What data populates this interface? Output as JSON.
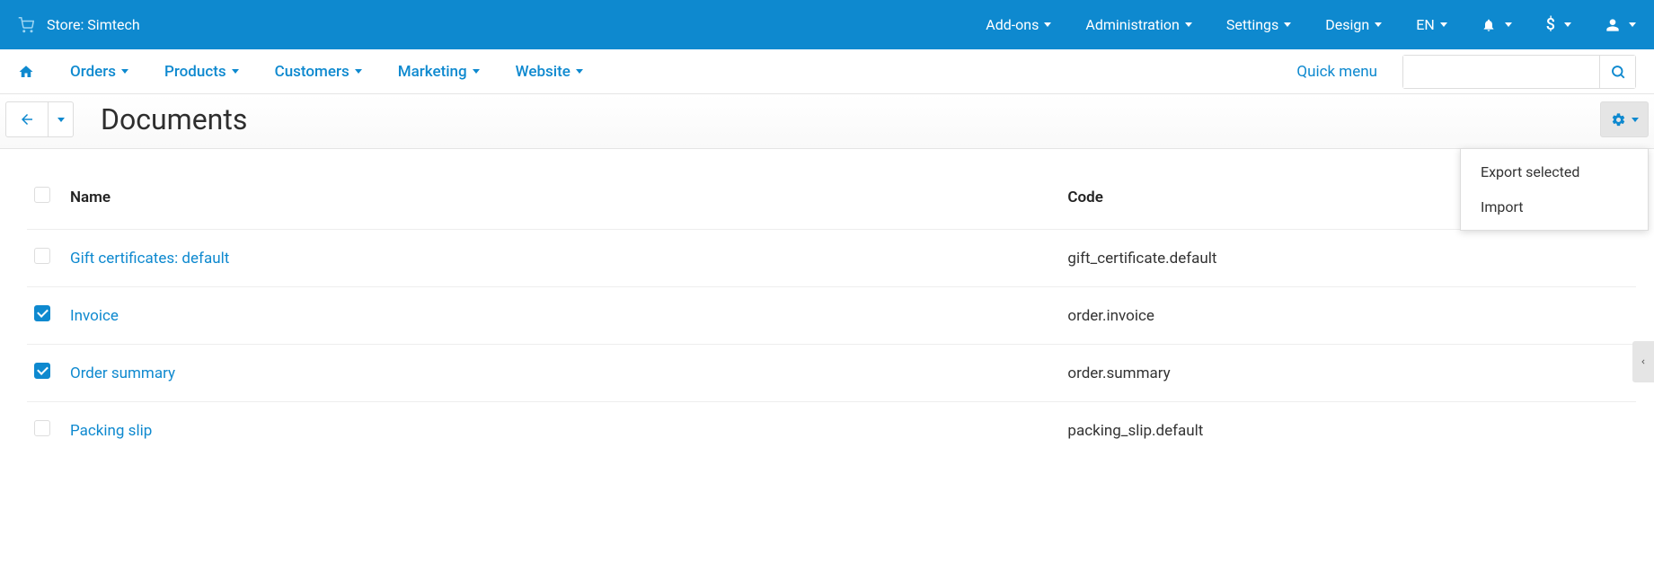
{
  "topbar": {
    "store_label": "Store: Simtech",
    "menu": {
      "addons": "Add-ons",
      "administration": "Administration",
      "settings": "Settings",
      "design": "Design",
      "language": "EN",
      "currency": "$"
    }
  },
  "navbar": {
    "orders": "Orders",
    "products": "Products",
    "customers": "Customers",
    "marketing": "Marketing",
    "website": "Website",
    "quick_menu": "Quick menu"
  },
  "page": {
    "title": "Documents"
  },
  "gear_menu": {
    "export_selected": "Export selected",
    "import": "Import"
  },
  "table": {
    "headers": {
      "name": "Name",
      "code": "Code"
    },
    "rows": [
      {
        "checked": false,
        "name": "Gift certificates: default",
        "code": "gift_certificate.default"
      },
      {
        "checked": true,
        "name": "Invoice",
        "code": "order.invoice"
      },
      {
        "checked": true,
        "name": "Order summary",
        "code": "order.summary"
      },
      {
        "checked": false,
        "name": "Packing slip",
        "code": "packing_slip.default"
      }
    ]
  }
}
